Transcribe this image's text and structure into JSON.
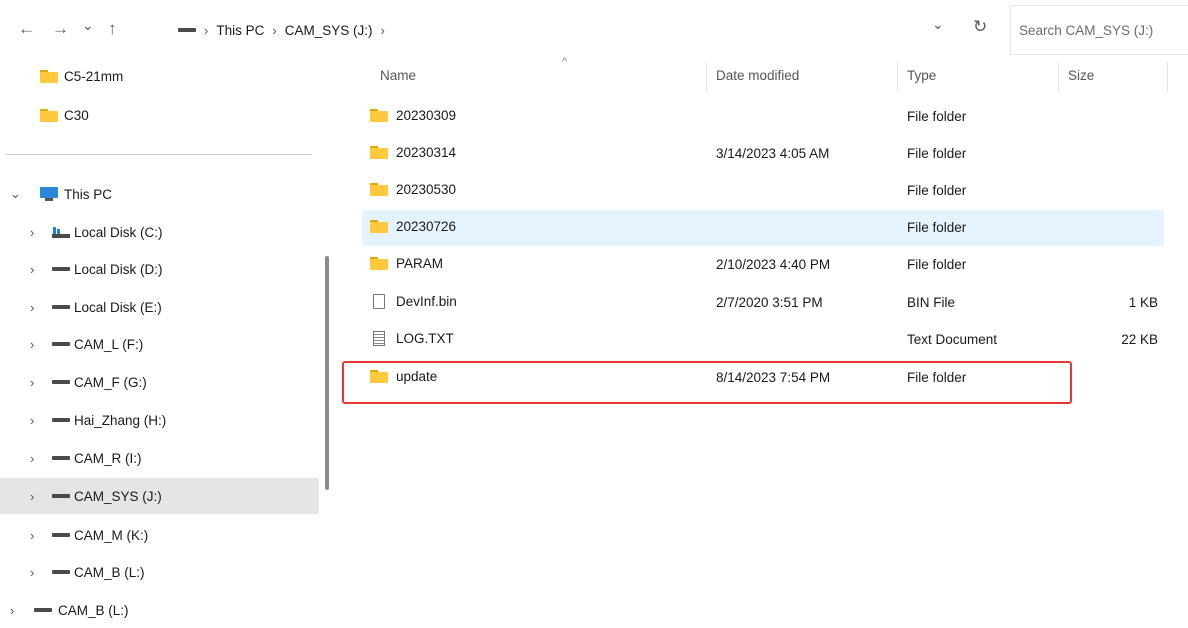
{
  "toolbar": {
    "back_icon": "←",
    "forward_icon": "→",
    "recent_icon": "⌄",
    "up_icon": "↑",
    "dropdown_icon": "⌄",
    "refresh_icon": "↻"
  },
  "breadcrumb": {
    "sep": "›",
    "items": [
      "This PC",
      "CAM_SYS (J:)"
    ]
  },
  "search": {
    "placeholder": "Search CAM_SYS (J:)"
  },
  "nav": {
    "collapsed": "›",
    "expanded": "⌄",
    "quick": [
      "C5-21mm",
      "C30"
    ],
    "this_pc": "This PC",
    "drives": [
      "Local Disk (C:)",
      "Local Disk (D:)",
      "Local Disk (E:)",
      "CAM_L (F:)",
      "CAM_F (G:)",
      "Hai_Zhang (H:)",
      "CAM_R (I:)",
      "CAM_SYS (J:)",
      "CAM_M (K:)",
      "CAM_B (L:)"
    ],
    "extra": "CAM_B (L:)"
  },
  "columns": {
    "name": "Name",
    "date": "Date modified",
    "type": "Type",
    "size": "Size",
    "sort_icon": "^"
  },
  "files": [
    {
      "name": "20230309",
      "date": "",
      "type": "File folder",
      "size": "",
      "icon": "folder-icon"
    },
    {
      "name": "20230314",
      "date": "3/14/2023 4:05 AM",
      "type": "File folder",
      "size": "",
      "icon": "folder-icon"
    },
    {
      "name": "20230530",
      "date": "",
      "type": "File folder",
      "size": "",
      "icon": "folder-icon"
    },
    {
      "name": "20230726",
      "date": "",
      "type": "File folder",
      "size": "",
      "icon": "folder-icon"
    },
    {
      "name": "PARAM",
      "date": "2/10/2023 4:40 PM",
      "type": "File folder",
      "size": "",
      "icon": "folder-icon"
    },
    {
      "name": "DevInf.bin",
      "date": "2/7/2020 3:51 PM",
      "type": "BIN File",
      "size": "1 KB",
      "icon": "file-icon"
    },
    {
      "name": "LOG.TXT",
      "date": "",
      "type": "Text Document",
      "size": "22 KB",
      "icon": "text-document-icon"
    },
    {
      "name": "update",
      "date": "8/14/2023 7:54 PM",
      "type": "File folder",
      "size": "",
      "icon": "folder-icon"
    }
  ],
  "colors": {
    "hover_row": "#e5f3ff",
    "selected_nav": "#e5e5e5",
    "highlight_box": "#e53935",
    "folder": "#ffc83d"
  }
}
